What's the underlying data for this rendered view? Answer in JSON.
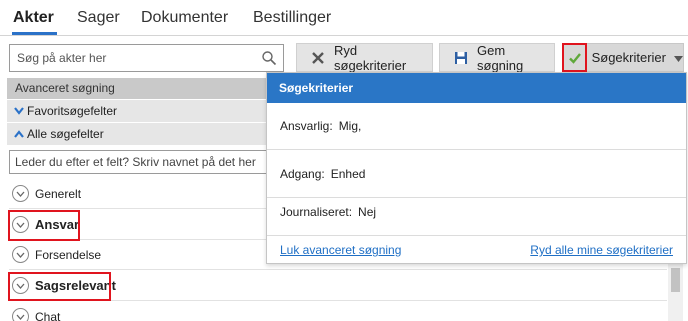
{
  "tabs": [
    {
      "label": "Akter",
      "active": true
    },
    {
      "label": "Sager",
      "active": false
    },
    {
      "label": "Dokumenter",
      "active": false
    },
    {
      "label": "Bestillinger",
      "active": false
    }
  ],
  "search": {
    "placeholder": "Søg på akter her",
    "value": ""
  },
  "toolbar": {
    "clear_label": "Ryd søgekriterier",
    "save_label": "Gem søgning",
    "criteria_label": "Søgekriterier"
  },
  "left": {
    "advanced_header": "Avanceret søgning",
    "favorites_label": "Favoritsøgefelter",
    "all_fields_label": "Alle søgefelter",
    "field_search_placeholder": "Leder du efter et felt? Skriv navnet på det her",
    "groups": [
      {
        "label": "Generelt",
        "bold": false,
        "highlighted": false
      },
      {
        "label": "Ansvar",
        "bold": true,
        "highlighted": true
      },
      {
        "label": "Forsendelse",
        "bold": false,
        "highlighted": false
      },
      {
        "label": "Sagsrelevant",
        "bold": true,
        "highlighted": true
      },
      {
        "label": "Chat",
        "bold": false,
        "highlighted": false
      }
    ]
  },
  "dropdown": {
    "title": "Søgekriterier",
    "criteria": [
      {
        "label": "Ansvarlig:",
        "value": "Mig,"
      },
      {
        "label": "Adgang:",
        "value": "Enhed"
      },
      {
        "label": "Journaliseret:",
        "value": "Nej"
      }
    ],
    "close_link": "Luk avanceret søgning",
    "clear_all_link": "Ryd alle mine søgekriterier"
  },
  "colors": {
    "accent": "#2b72c8",
    "highlight": "#e0141e",
    "check": "#5fa83a"
  }
}
